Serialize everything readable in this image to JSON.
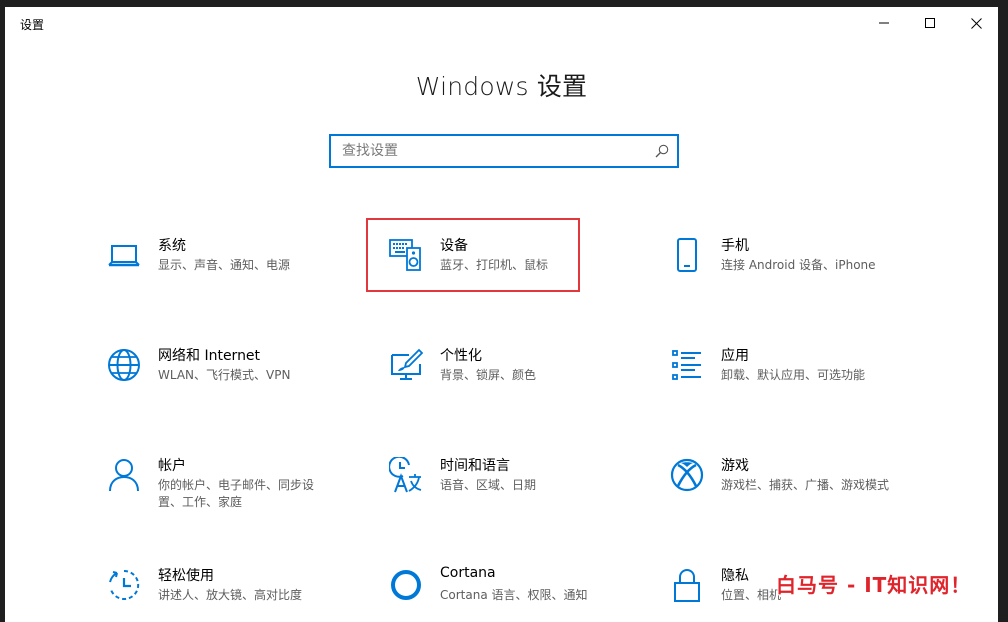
{
  "window": {
    "title": "设置"
  },
  "page": {
    "title": "Windows 设置"
  },
  "search": {
    "placeholder": "查找设置"
  },
  "tiles": [
    {
      "title": "系统",
      "desc": "显示、声音、通知、电源",
      "icon": "laptop-icon"
    },
    {
      "title": "设备",
      "desc": "蓝牙、打印机、鼠标",
      "icon": "keyboard-speaker-icon"
    },
    {
      "title": "手机",
      "desc": "连接 Android 设备、iPhone",
      "icon": "phone-icon"
    },
    {
      "title": "网络和 Internet",
      "desc": "WLAN、飞行模式、VPN",
      "icon": "globe-icon"
    },
    {
      "title": "个性化",
      "desc": "背景、锁屏、颜色",
      "icon": "paint-monitor-icon"
    },
    {
      "title": "应用",
      "desc": "卸载、默认应用、可选功能",
      "icon": "app-list-icon"
    },
    {
      "title": "帐户",
      "desc": "你的帐户、电子邮件、同步设置、工作、家庭",
      "icon": "person-icon"
    },
    {
      "title": "时间和语言",
      "desc": "语音、区域、日期",
      "icon": "time-language-icon"
    },
    {
      "title": "游戏",
      "desc": "游戏栏、捕获、广播、游戏模式",
      "icon": "xbox-icon"
    },
    {
      "title": "轻松使用",
      "desc": "讲述人、放大镜、高对比度",
      "icon": "ease-of-access-icon"
    },
    {
      "title": "Cortana",
      "desc": "Cortana 语言、权限、通知",
      "icon": "cortana-icon"
    },
    {
      "title": "隐私",
      "desc": "位置、相机",
      "icon": "lock-icon"
    }
  ],
  "watermark": {
    "text": "白马号 - IT知识网！"
  },
  "colors": {
    "accent": "#0078d7",
    "highlight": "#e0383d",
    "watermark": "#e0242b"
  }
}
